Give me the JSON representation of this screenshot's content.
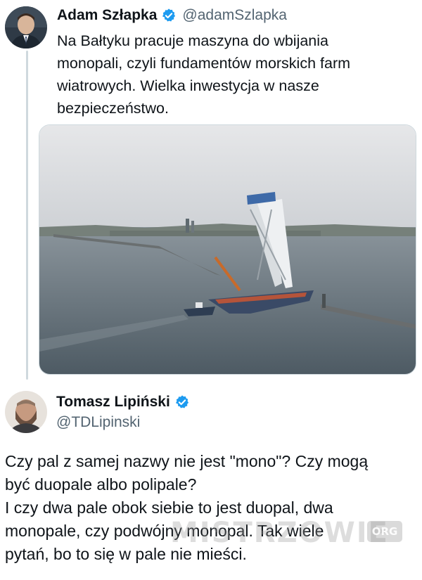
{
  "tweet1": {
    "author_name": "Adam Szłapka",
    "author_handle": "@adamSzlapka",
    "text_lines": [
      "Na Bałtyku pracuje maszyna do wbijania",
      "monopali, czyli fundamentów morskich farm",
      "wiatrowych. Wielka inwestycja w nasze",
      "bezpieczeństwo."
    ]
  },
  "tweet2": {
    "author_name": "Tomasz Lipiński",
    "author_handle": "@TDLipinski",
    "text_lines": [
      "Czy pal z samej nazwy nie jest \"mono\"? Czy mogą",
      "być duopale albo polipale?",
      "I czy dwa pale obok siebie to jest duopal, dwa",
      "monopale, czy podwójny monopal. Tak wiele",
      "pytań, bo to się w pale nie mieści."
    ]
  },
  "watermark": {
    "text": "MISTRZOWIE",
    "badge": "ORG"
  },
  "icons": {
    "verified": "verified-badge-icon",
    "avatar1": "avatar",
    "avatar2": "avatar",
    "media": "photo"
  },
  "colors": {
    "verified_blue": "#1d9bf0",
    "text_primary": "#0f1419",
    "text_secondary": "#536471",
    "thread_line": "#cfd9de"
  }
}
